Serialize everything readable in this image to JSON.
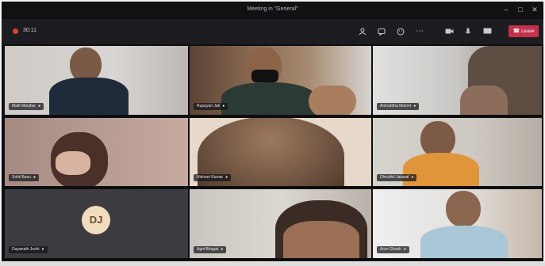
{
  "window": {
    "title": "Meeting in \"General\""
  },
  "toolbar": {
    "timer": "30:11",
    "leave_label": "Leave",
    "icons": [
      "participants-icon",
      "chat-icon",
      "reactions-icon",
      "more-actions-icon",
      "camera-icon",
      "mic-icon",
      "share-screen-icon"
    ]
  },
  "participants": [
    {
      "name": "Malit Manjhar",
      "type": "video"
    },
    {
      "name": "Rupayan Jati",
      "type": "video"
    },
    {
      "name": "Aniruddha Meinet",
      "type": "video"
    },
    {
      "name": "Sohil Basu",
      "type": "video"
    },
    {
      "name": "Nishant Kumar",
      "type": "video"
    },
    {
      "name": "Dhrubhil Jaiswal",
      "type": "video"
    },
    {
      "name": "Dayanath Joshi",
      "type": "avatar",
      "initials": "DJ"
    },
    {
      "name": "Agni Bhagat",
      "type": "video"
    },
    {
      "name": "Aron Ghosh",
      "type": "video"
    }
  ],
  "colors": {
    "leave_button": "#c4314b",
    "toolbar": "#1d1d21",
    "avatar_bg": "#f2dcc0"
  }
}
